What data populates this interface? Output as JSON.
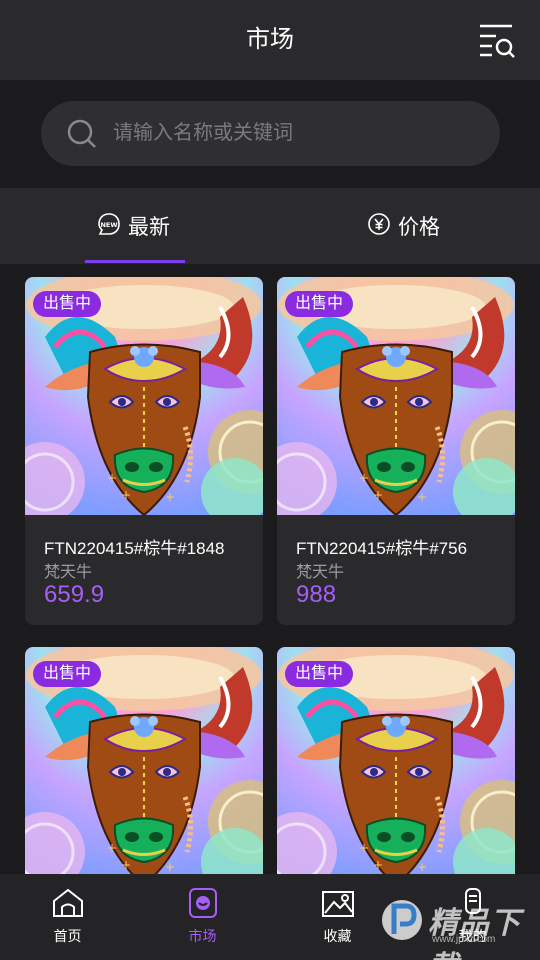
{
  "header": {
    "title": "市场",
    "filter_icon": "list-search-icon"
  },
  "search": {
    "placeholder": "请输入名称或关键词"
  },
  "tabs": [
    {
      "label": "最新",
      "icon": "new-badge-icon",
      "active": true
    },
    {
      "label": "价格",
      "icon": "yuan-circle-icon",
      "active": false
    }
  ],
  "cards": [
    {
      "badge": "出售中",
      "title": "FTN220415#棕牛#1848",
      "creator": "梵天牛",
      "price": "659.9"
    },
    {
      "badge": "出售中",
      "title": "FTN220415#棕牛#756",
      "creator": "梵天牛",
      "price": "988"
    },
    {
      "badge": "出售中",
      "title": "",
      "creator": "",
      "price": ""
    },
    {
      "badge": "出售中",
      "title": "",
      "creator": "",
      "price": ""
    }
  ],
  "bottom_nav": [
    {
      "label": "首页",
      "icon": "home-icon",
      "active": false
    },
    {
      "label": "市场",
      "icon": "market-icon",
      "active": true
    },
    {
      "label": "收藏",
      "icon": "image-collection-icon",
      "active": false
    },
    {
      "label": "我的",
      "icon": "profile-icon",
      "active": false
    }
  ],
  "watermark": {
    "text": "精品下载",
    "url_text": "www.jpxz.com"
  },
  "colors": {
    "accent": "#a65ef5",
    "badge": "#8a2be2",
    "background": "#1b1b1d",
    "surface": "#2a2a2c"
  }
}
